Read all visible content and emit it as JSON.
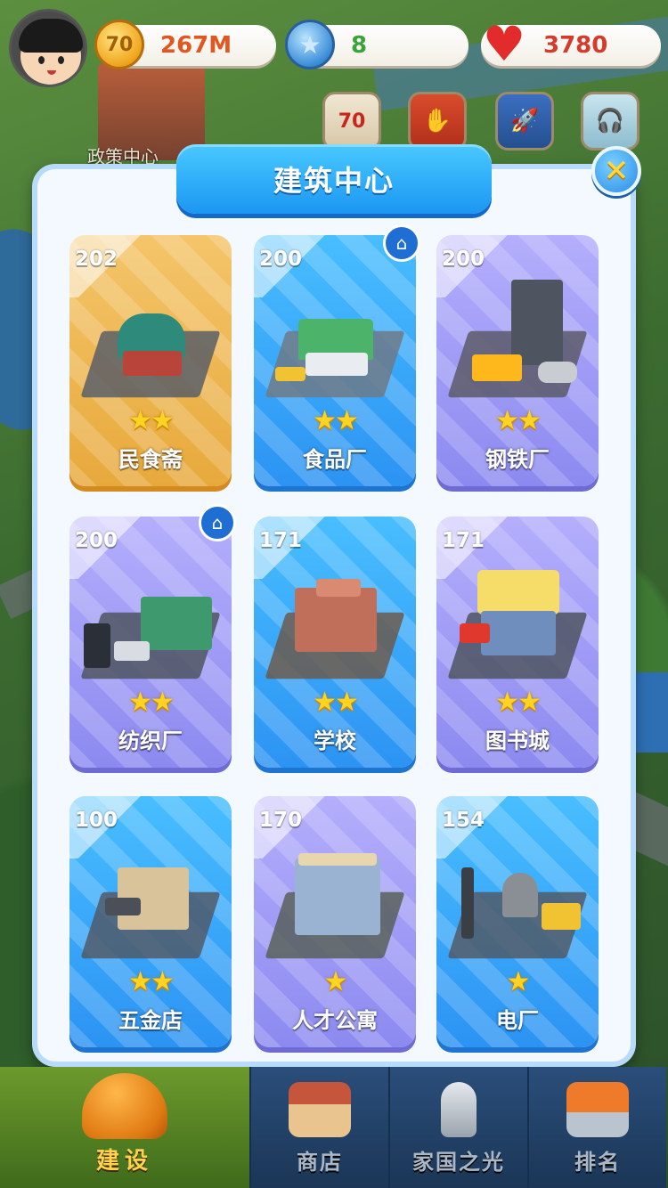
{
  "hud": {
    "coins": {
      "value": "267M",
      "icon": "coin-70-icon",
      "icon_text": "70"
    },
    "stars": {
      "value": "8",
      "icon": "blue-star-icon"
    },
    "hearts": {
      "value": "3780",
      "icon": "heart-icon"
    },
    "quick_buttons": [
      {
        "name": "event-70-button",
        "icon": "event-70-icon",
        "icon_text": "70"
      },
      {
        "name": "handshake-button",
        "icon": "handshake-icon"
      },
      {
        "name": "rocket-event-button",
        "icon": "rocket-icon"
      },
      {
        "name": "support-button",
        "icon": "headset-agent-icon"
      }
    ]
  },
  "map": {
    "policy_label": "政策中心"
  },
  "panel": {
    "title": "建筑中心",
    "close_icon": "close-icon",
    "buildings": [
      {
        "name": "民食斋",
        "count": "202",
        "stars": 2,
        "theme": "gold",
        "has_home_badge": false
      },
      {
        "name": "食品厂",
        "count": "200",
        "stars": 2,
        "theme": "blue",
        "has_home_badge": true
      },
      {
        "name": "钢铁厂",
        "count": "200",
        "stars": 2,
        "theme": "purple",
        "has_home_badge": false
      },
      {
        "name": "纺织厂",
        "count": "200",
        "stars": 2,
        "theme": "purple",
        "has_home_badge": true
      },
      {
        "name": "学校",
        "count": "171",
        "stars": 2,
        "theme": "blue",
        "has_home_badge": false
      },
      {
        "name": "图书城",
        "count": "171",
        "stars": 2,
        "theme": "purple",
        "has_home_badge": false
      },
      {
        "name": "五金店",
        "count": "100",
        "stars": 2,
        "theme": "blue",
        "has_home_badge": false
      },
      {
        "name": "人才公寓",
        "count": "170",
        "stars": 1,
        "theme": "purple",
        "has_home_badge": false
      },
      {
        "name": "电厂",
        "count": "154",
        "stars": 1,
        "theme": "blue",
        "has_home_badge": false
      }
    ]
  },
  "bottom_nav": [
    {
      "label": "建设",
      "icon": "hard-hat-icon",
      "active": true
    },
    {
      "label": "商店",
      "icon": "shop-icon",
      "active": false
    },
    {
      "label": "家国之光",
      "icon": "rocket-icon",
      "active": false
    },
    {
      "label": "排名",
      "icon": "ranking-icon",
      "active": false
    }
  ]
}
